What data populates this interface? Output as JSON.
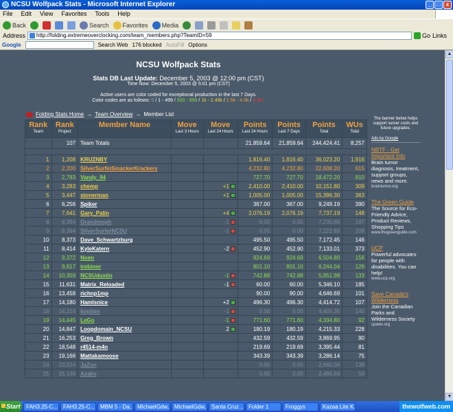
{
  "window": {
    "title": "NCSU Wolfpack Stats - Microsoft Internet Explorer"
  },
  "menu": [
    "File",
    "Edit",
    "View",
    "Favorites",
    "Tools",
    "Help"
  ],
  "toolbar": {
    "back": "Back",
    "search": "Search",
    "favorites": "Favorites",
    "media": "Media"
  },
  "address": {
    "label": "Address",
    "url": "http://folding.extremeoverclocking.com/team_members.php?TeamID=59",
    "go": "Go",
    "links": "Links"
  },
  "google": {
    "logo": "Google",
    "search_web": "Search Web",
    "blocked": "176 blocked",
    "autofill": "AutoFill",
    "options": "Options"
  },
  "page": {
    "title": "NCSU Wolfpack Stats",
    "update_label": "Stats DB Last Update:",
    "update_value": "December 5, 2003 @ 12:00 pm (CST)",
    "time_now": "Time Now: December 5, 2003 @ 5:01 pm (CST)",
    "note_line1": "Active users are color coded for exceptional production in the last 7 Days.",
    "color_codes_label": "Color codes are as follows:",
    "codes": [
      "0",
      "1 - 499",
      "500 - 999",
      "1k - 2.49k",
      "2.5k - 4.5k",
      "4.5k+"
    ]
  },
  "breadcrumb": {
    "home": "Folding Stats Home",
    "overview": "Team Overview",
    "current": "Member List",
    "sep": "→"
  },
  "table": {
    "headers": [
      {
        "t": "Rank",
        "s": "Team"
      },
      {
        "t": "Rank",
        "s": "Project"
      },
      {
        "t": "Member Name",
        "s": ""
      },
      {
        "t": "Move",
        "s": "Last 3 Hours"
      },
      {
        "t": "Move",
        "s": "Last 24 Hours"
      },
      {
        "t": "Points",
        "s": "Last 24 Hours"
      },
      {
        "t": "Points",
        "s": "Last 7 Days"
      },
      {
        "t": "Points",
        "s": "Total"
      },
      {
        "t": "WUs",
        "s": "Total"
      }
    ],
    "totals": {
      "rank": "107",
      "name": "Team Totals",
      "p24": "21,859.64",
      "p7": "21,859.64",
      "total": "244,424.41",
      "wus": "8,257"
    },
    "rows": [
      {
        "r": "1",
        "p": "1,208",
        "n": "KRUZNBY",
        "m3": "",
        "m24": "",
        "p24": "1,816.40",
        "p7": "1,816.40",
        "t": "36,023.20",
        "w": "1,916",
        "c": "y"
      },
      {
        "r": "2",
        "p": "2,200",
        "n": "SilverSurfinSmackerKrackers",
        "m3": "",
        "m24": "",
        "p24": "4,232.80",
        "p7": "4,232.80",
        "t": "22,608.20",
        "w": "615",
        "c": "o"
      },
      {
        "r": "3",
        "p": "2,783",
        "n": "Vandy_94",
        "m3": "",
        "m24": "",
        "p24": "727.70",
        "p7": "727.70",
        "t": "18,472.20",
        "w": "810",
        "c": "g"
      },
      {
        "r": "4",
        "p": "3,283",
        "n": "chemp",
        "m3": "",
        "m24": "+1",
        "p24": "2,410.00",
        "p7": "2,410.00",
        "t": "10,151.80",
        "w": "309",
        "c": "y"
      },
      {
        "r": "5",
        "p": "3,447",
        "n": "stonerman",
        "m3": "",
        "m24": "+1",
        "p24": "1,005.00",
        "p7": "1,005.00",
        "t": "15,396.30",
        "w": "363",
        "c": "y"
      },
      {
        "r": "6",
        "p": "6,256",
        "n": "Spiker",
        "m3": "",
        "m24": "",
        "p24": "367.00",
        "p7": "367.00",
        "t": "9,249.19",
        "w": "390",
        "c": "w"
      },
      {
        "r": "7",
        "p": "7,641",
        "n": "Gary_Palin",
        "m3": "",
        "m24": "+4",
        "p24": "2,076.19",
        "p7": "2,076.19",
        "t": "7,737.19",
        "w": "148",
        "c": "y"
      },
      {
        "r": "8",
        "p": "8,394",
        "n": "Grandmoph",
        "m3": "",
        "m24": "-1",
        "p24": "0.00",
        "p7": "0.00",
        "t": "7,230.65",
        "w": "187",
        "c": "z"
      },
      {
        "r": "9",
        "p": "8,394",
        "n": "SilverSurferNCSU",
        "m3": "",
        "m24": "-1",
        "p24": "0.00",
        "p7": "0.00",
        "t": "7,222.89",
        "w": "208",
        "c": "z"
      },
      {
        "r": "10",
        "p": "8,373",
        "n": "Dave_Schwartzburg",
        "m3": "",
        "m24": "",
        "p24": "495.50",
        "p7": "495.50",
        "t": "7,172.45",
        "w": "146",
        "c": "w"
      },
      {
        "r": "11",
        "p": "8,414",
        "n": "KyleKatern",
        "m3": "",
        "m24": "-2",
        "p24": "452.90",
        "p7": "452.90",
        "t": "7,133.01",
        "w": "373",
        "c": "w"
      },
      {
        "r": "12",
        "p": "9,372",
        "n": "Noen",
        "m3": "",
        "m24": "",
        "p24": "924.69",
        "p7": "924.69",
        "t": "6,504.80",
        "w": "156",
        "c": "g"
      },
      {
        "r": "13",
        "p": "9,817",
        "n": "trebinor",
        "m3": "",
        "m24": "",
        "p24": "801.10",
        "p7": "801.10",
        "t": "6,244.04",
        "w": "129",
        "c": "g"
      },
      {
        "r": "14",
        "p": "10,359",
        "n": "NCSUdustin",
        "m3": "",
        "m24": "-1",
        "p24": "742.88",
        "p7": "742.88",
        "t": "5,851.98",
        "w": "133",
        "c": "g"
      },
      {
        "r": "15",
        "p": "11,631",
        "n": "Matrix_Reloaded",
        "m3": "",
        "m24": "-1",
        "p24": "60.00",
        "p7": "60.00",
        "t": "5,346.10",
        "w": "185",
        "c": "w"
      },
      {
        "r": "16",
        "p": "13,458",
        "n": "richnp1mp",
        "m3": "",
        "m24": "",
        "p24": "90.00",
        "p7": "90.00",
        "t": "4,646.69",
        "w": "101",
        "c": "w"
      },
      {
        "r": "17",
        "p": "14,180",
        "n": "Hamlsnice",
        "m3": "",
        "m24": "+2",
        "p24": "496.30",
        "p7": "496.30",
        "t": "4,414.72",
        "w": "107",
        "c": "w"
      },
      {
        "r": "18",
        "p": "14,214",
        "n": "kopiten",
        "m3": "",
        "m24": "-1",
        "p24": "0.00",
        "p7": "0.00",
        "t": "4,405.35",
        "w": "140",
        "c": "z"
      },
      {
        "r": "19",
        "p": "14,445",
        "n": "LeGo",
        "m3": "",
        "m24": "-1",
        "p24": "771.60",
        "p7": "771.60",
        "t": "4,334.80",
        "w": "92",
        "c": "g"
      },
      {
        "r": "20",
        "p": "14,847",
        "n": "Loopdomain_NCSU",
        "m3": "",
        "m24": "2",
        "p24": "180.19",
        "p7": "180.19",
        "t": "4,215.33",
        "w": "228",
        "c": "w"
      },
      {
        "r": "21",
        "p": "16,253",
        "n": "Greg_Brown",
        "m3": "",
        "m24": "",
        "p24": "432.59",
        "p7": "432.59",
        "t": "3,869.95",
        "w": "90",
        "c": "w"
      },
      {
        "r": "22",
        "p": "18,548",
        "n": "r4514-m4n",
        "m3": "",
        "m24": "",
        "p24": "219.69",
        "p7": "219.69",
        "t": "3,395.44",
        "w": "81",
        "c": "w"
      },
      {
        "r": "23",
        "p": "19,166",
        "n": "Mattakamoose",
        "m3": "",
        "m24": "",
        "p24": "343.39",
        "p7": "343.39",
        "t": "3,286.14",
        "w": "75",
        "c": "w"
      },
      {
        "r": "24",
        "p": "23,514",
        "n": "JaZon",
        "m3": "",
        "m24": "",
        "p24": "0.00",
        "p7": "0.00",
        "t": "2,660.06",
        "w": "138",
        "c": "z"
      },
      {
        "r": "25",
        "p": "25,146",
        "n": "Azako",
        "m3": "",
        "m24": "",
        "p24": "0.00",
        "p7": "0.00",
        "t": "2,486.69",
        "w": "59",
        "c": "z"
      }
    ]
  },
  "sidebar": {
    "banner": "The banner below helps support server costs and future upgrades.",
    "adsby": "Ads by Google",
    "ads": [
      {
        "title": "NBTF - Get Important Info",
        "body": "Brain tumor diagnosis, treatment, support groups, news and more.",
        "url": "braintumor.org"
      },
      {
        "title": "The Green Guide",
        "body": "The Source for Eco-Friendly Advice, Product Reviews, Shopping Tips",
        "url": "www.thegreenguide.com"
      },
      {
        "title": "UCP",
        "body": "Powerful advocates for people with disabilities. You can help!",
        "url": "www.ucp.org"
      },
      {
        "title": "Save Canada's Wilderness",
        "body": "Join the Canadian Parks and Wilderness Society",
        "url": "cpaws.org"
      }
    ]
  },
  "taskbar": {
    "start": "Start",
    "tasks": [
      "FAH3.25-C...",
      "FAH3.25-C...",
      "MBM 5 - Da...",
      "MichaelGdw...",
      "MichaelGdw...",
      "Santa Cruz ...",
      "Folder 1",
      "Froggys",
      "Kazaa Lite K..."
    ],
    "tray": "thewolfweb.com"
  },
  "colors": {
    "y": "#f0d04a",
    "o": "#f0a040",
    "g": "#8fdc4c",
    "w": "#ffffff",
    "z": "#7d8d9d"
  }
}
